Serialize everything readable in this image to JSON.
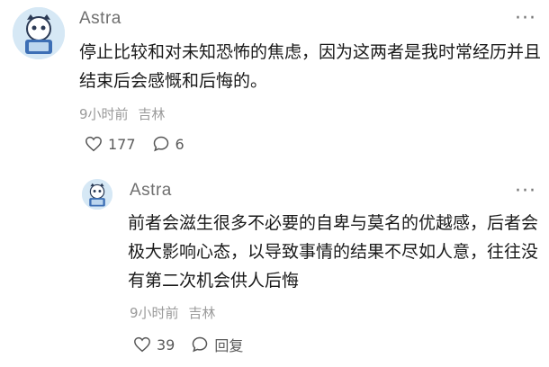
{
  "comments": [
    {
      "username": "Astra",
      "more_icon": "more-dots-icon",
      "text": "停止比较和对未知恐怖的焦虑，因为这两者是我时常经历并且结束后会感慨和后悔的。",
      "time": "9小时前",
      "location": "吉林",
      "likes": "177",
      "replies": "6"
    },
    {
      "username": "Astra",
      "more_icon": "more-dots-icon",
      "text": "前者会滋生很多不必要的自卑与莫名的优越感，后者会极大影响心态，以导致事情的结果不尽如人意，往往没有第二次机会供人后悔",
      "time": "9小时前",
      "location": "吉林",
      "likes": "39",
      "reply_label": "回复"
    }
  ]
}
